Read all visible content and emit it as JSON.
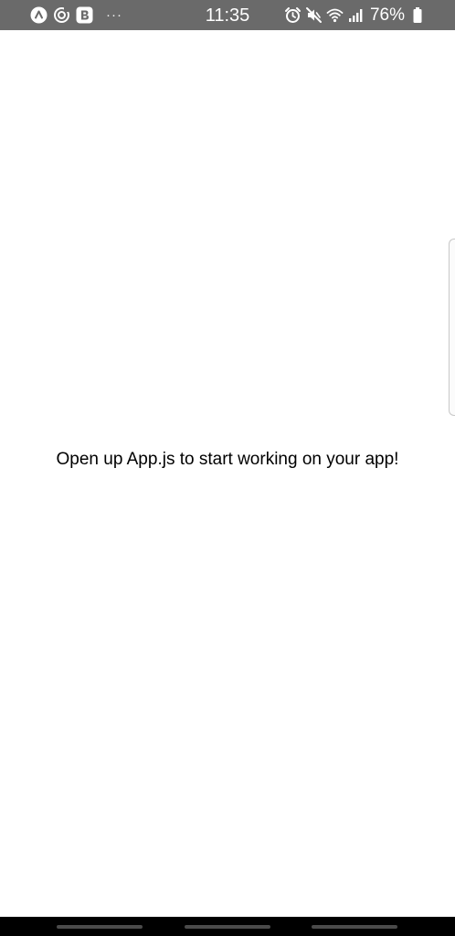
{
  "status_bar": {
    "time": "11:35",
    "battery_percent": "76%",
    "more_indicator": "···",
    "notification_icons": [
      "app-a-icon",
      "sync-icon",
      "b-app-icon"
    ],
    "system_icons": [
      "alarm-icon",
      "mute-icon",
      "wifi-icon",
      "signal-icon",
      "battery-icon"
    ]
  },
  "main": {
    "welcome_text": "Open up App.js to start working on your app!"
  },
  "colors": {
    "status_bar_bg": "#6a6a6a",
    "nav_bar_bg": "#000000",
    "content_bg": "#ffffff"
  }
}
